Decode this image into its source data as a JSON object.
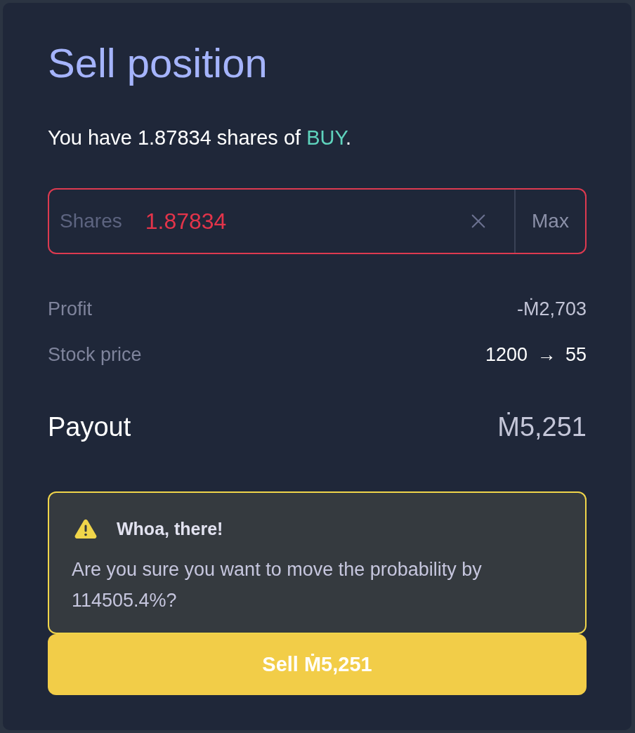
{
  "sell_dialog": {
    "title": "Sell position",
    "summary": {
      "before": "You have 1.87834 shares of ",
      "outcome": "BUY",
      "after": "."
    },
    "shares_field": {
      "label": "Shares",
      "value": "1.87834",
      "invalid": true,
      "max_label": "Max"
    },
    "rows": [
      {
        "kind": "amount",
        "label": "Profit",
        "value": "-Ṁ2,703"
      },
      {
        "kind": "change",
        "label": "Stock price",
        "value": "1200 → 55"
      }
    ],
    "payout": {
      "label": "Payout",
      "value": "Ṁ5,251"
    },
    "warning": {
      "title": "Whoa, there!",
      "message": "Are you sure you want to move the probability by 114505.4%?"
    },
    "submit": {
      "label": "Sell Ṁ5,251"
    }
  }
}
